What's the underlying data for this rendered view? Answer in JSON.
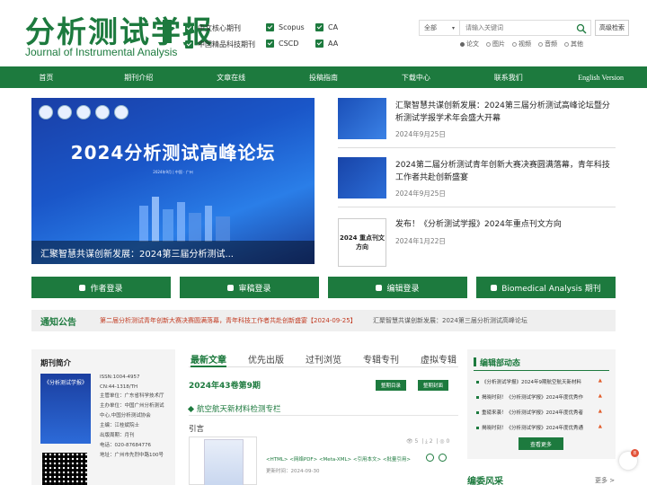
{
  "header": {
    "logo_cn": "分析测试学报",
    "logo_en": "Journal of Instrumental Analysis",
    "indexes": [
      "中文核心期刊",
      "Scopus",
      "CA",
      "中国精品科技期刊",
      "CSCD",
      "AA"
    ],
    "search_scope": "全部",
    "search_placeholder": "请输入关键词",
    "advanced_search": "高级检索",
    "search_types": [
      "论文",
      "图片",
      "视频",
      "音频",
      "其他"
    ]
  },
  "nav": [
    "首页",
    "期刊介绍",
    "文章在线",
    "投稿指南",
    "下载中心",
    "联系我们",
    "English Version"
  ],
  "banner": {
    "title": "2024分析测试高峰论坛",
    "subtitle": "2024年9月 | 中国 · 广州",
    "caption": "汇聚智慧共谋创新发展：2024第三届分析测试..."
  },
  "news": [
    {
      "title": "汇聚智慧共谋创新发展：2024第三届分析测试高峰论坛暨分析测试学报学术年会盛大开幕",
      "date": "2024年9月25日"
    },
    {
      "title": "2024第二届分析测试青年创新大赛决赛圆满落幕，青年科技工作者共赴创新盛宴",
      "date": "2024年9月25日"
    },
    {
      "title": "发布！《分析测试学报》2024年重点刊文方向",
      "date": "2024年1月22日"
    }
  ],
  "news_thumb_3_text": "2024 重点刊文方向",
  "buttons": [
    "作者登录",
    "审稿登录",
    "编辑登录",
    "Biomedical Analysis 期刊"
  ],
  "notice": {
    "label": "通知公告",
    "items": [
      "第二届分析测试青年创新大赛决赛圆满落幕，青年科技工作者共赴创新盛宴【2024-09-25】",
      "汇聚智慧共谋创新发展：2024第三届分析测试高峰论坛"
    ]
  },
  "intro": {
    "title": "期刊简介",
    "cover_text": "《分析测试学报》",
    "lines": [
      "ISSN:1004-4957",
      "CN:44-1318/TH",
      "主管单位：广东省科学技术厅",
      "主办单位：中国广州分析测试",
      "中心,中国分析测试协会",
      "主编：江桂斌院士",
      "出版周期：月刊",
      "电话：020-87684776",
      "地址：广州市先烈中路100号"
    ]
  },
  "tabs": [
    "最新文章",
    "优先出版",
    "过刊浏览",
    "专辑专刊",
    "虚拟专辑"
  ],
  "issue": {
    "label": "2024年43卷第9期",
    "toc_btn": "整期目录",
    "cover_btn": "整期封面",
    "column": "航空航天新材料检测专栏",
    "article_label": "引言",
    "links": "<HTML> <网络PDF> <Meta-XML> <引用本文> <批量引用>",
    "date": "更新时间：2024-09-30",
    "stats": [
      "5",
      "2",
      "0"
    ]
  },
  "ednews": {
    "title": "编辑部动态",
    "items": [
      "《分析测试学报》2024年9期航空航天新材料",
      "揭晓时刻！《分析测试学报》2024年度优秀作",
      "重磅来袭！《分析测试学报》2024年度优秀者",
      "揭晓时刻！《分析测试学报》2024年度优秀通"
    ],
    "more": "查看更多"
  },
  "editors": {
    "title": "编委风采",
    "more": "更多 >"
  },
  "float_badge": "8",
  "colors": {
    "brand": "#1d7a3e",
    "notice_red": "#c23b22"
  }
}
